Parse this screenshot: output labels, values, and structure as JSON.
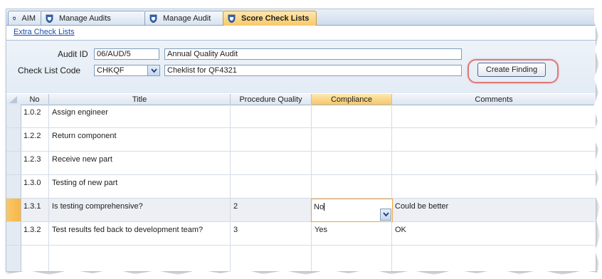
{
  "tabs": [
    {
      "label": "AIM",
      "active": false
    },
    {
      "label": "Manage Audits",
      "active": false
    },
    {
      "label": "Manage Audit",
      "active": false
    },
    {
      "label": "Score Check Lists",
      "active": true
    }
  ],
  "links": {
    "extra_check_lists": "Extra Check Lists"
  },
  "form": {
    "audit_id_label": "Audit ID",
    "audit_id_value": "06/AUD/5",
    "audit_name": "Annual Quality Audit",
    "checklist_code_label": "Check List Code",
    "checklist_code_value": "CHKQF",
    "checklist_name": "Cheklist for QF4321",
    "create_finding_label": "Create Finding"
  },
  "grid": {
    "columns": [
      "No",
      "Title",
      "Procedure Quality",
      "Compliance",
      "Comments"
    ],
    "selected_column": "Compliance",
    "rows": [
      {
        "no": "1.0.2",
        "title": "Assign engineer",
        "pq": "",
        "compliance": "",
        "comments": ""
      },
      {
        "no": "1.2.2",
        "title": "Return component",
        "pq": "",
        "compliance": "",
        "comments": ""
      },
      {
        "no": "1.2.3",
        "title": "Receive new part",
        "pq": "",
        "compliance": "",
        "comments": ""
      },
      {
        "no": "1.3.0",
        "title": "Testing of new part",
        "pq": "",
        "compliance": "",
        "comments": ""
      },
      {
        "no": "1.3.1",
        "title": "Is testing comprehensive?",
        "pq": "2",
        "compliance": "No",
        "comments": "Could be better"
      },
      {
        "no": "1.3.2",
        "title": "Test results fed back to development team?",
        "pq": "3",
        "compliance": "Yes",
        "comments": "OK"
      }
    ]
  },
  "colors": {
    "accent": "#f6c768",
    "highlight_ring": "#e07878",
    "link": "#1a4fa8"
  },
  "icons": {
    "tab_icon": "shield-icon",
    "dropdown": "chevron-down-icon"
  }
}
